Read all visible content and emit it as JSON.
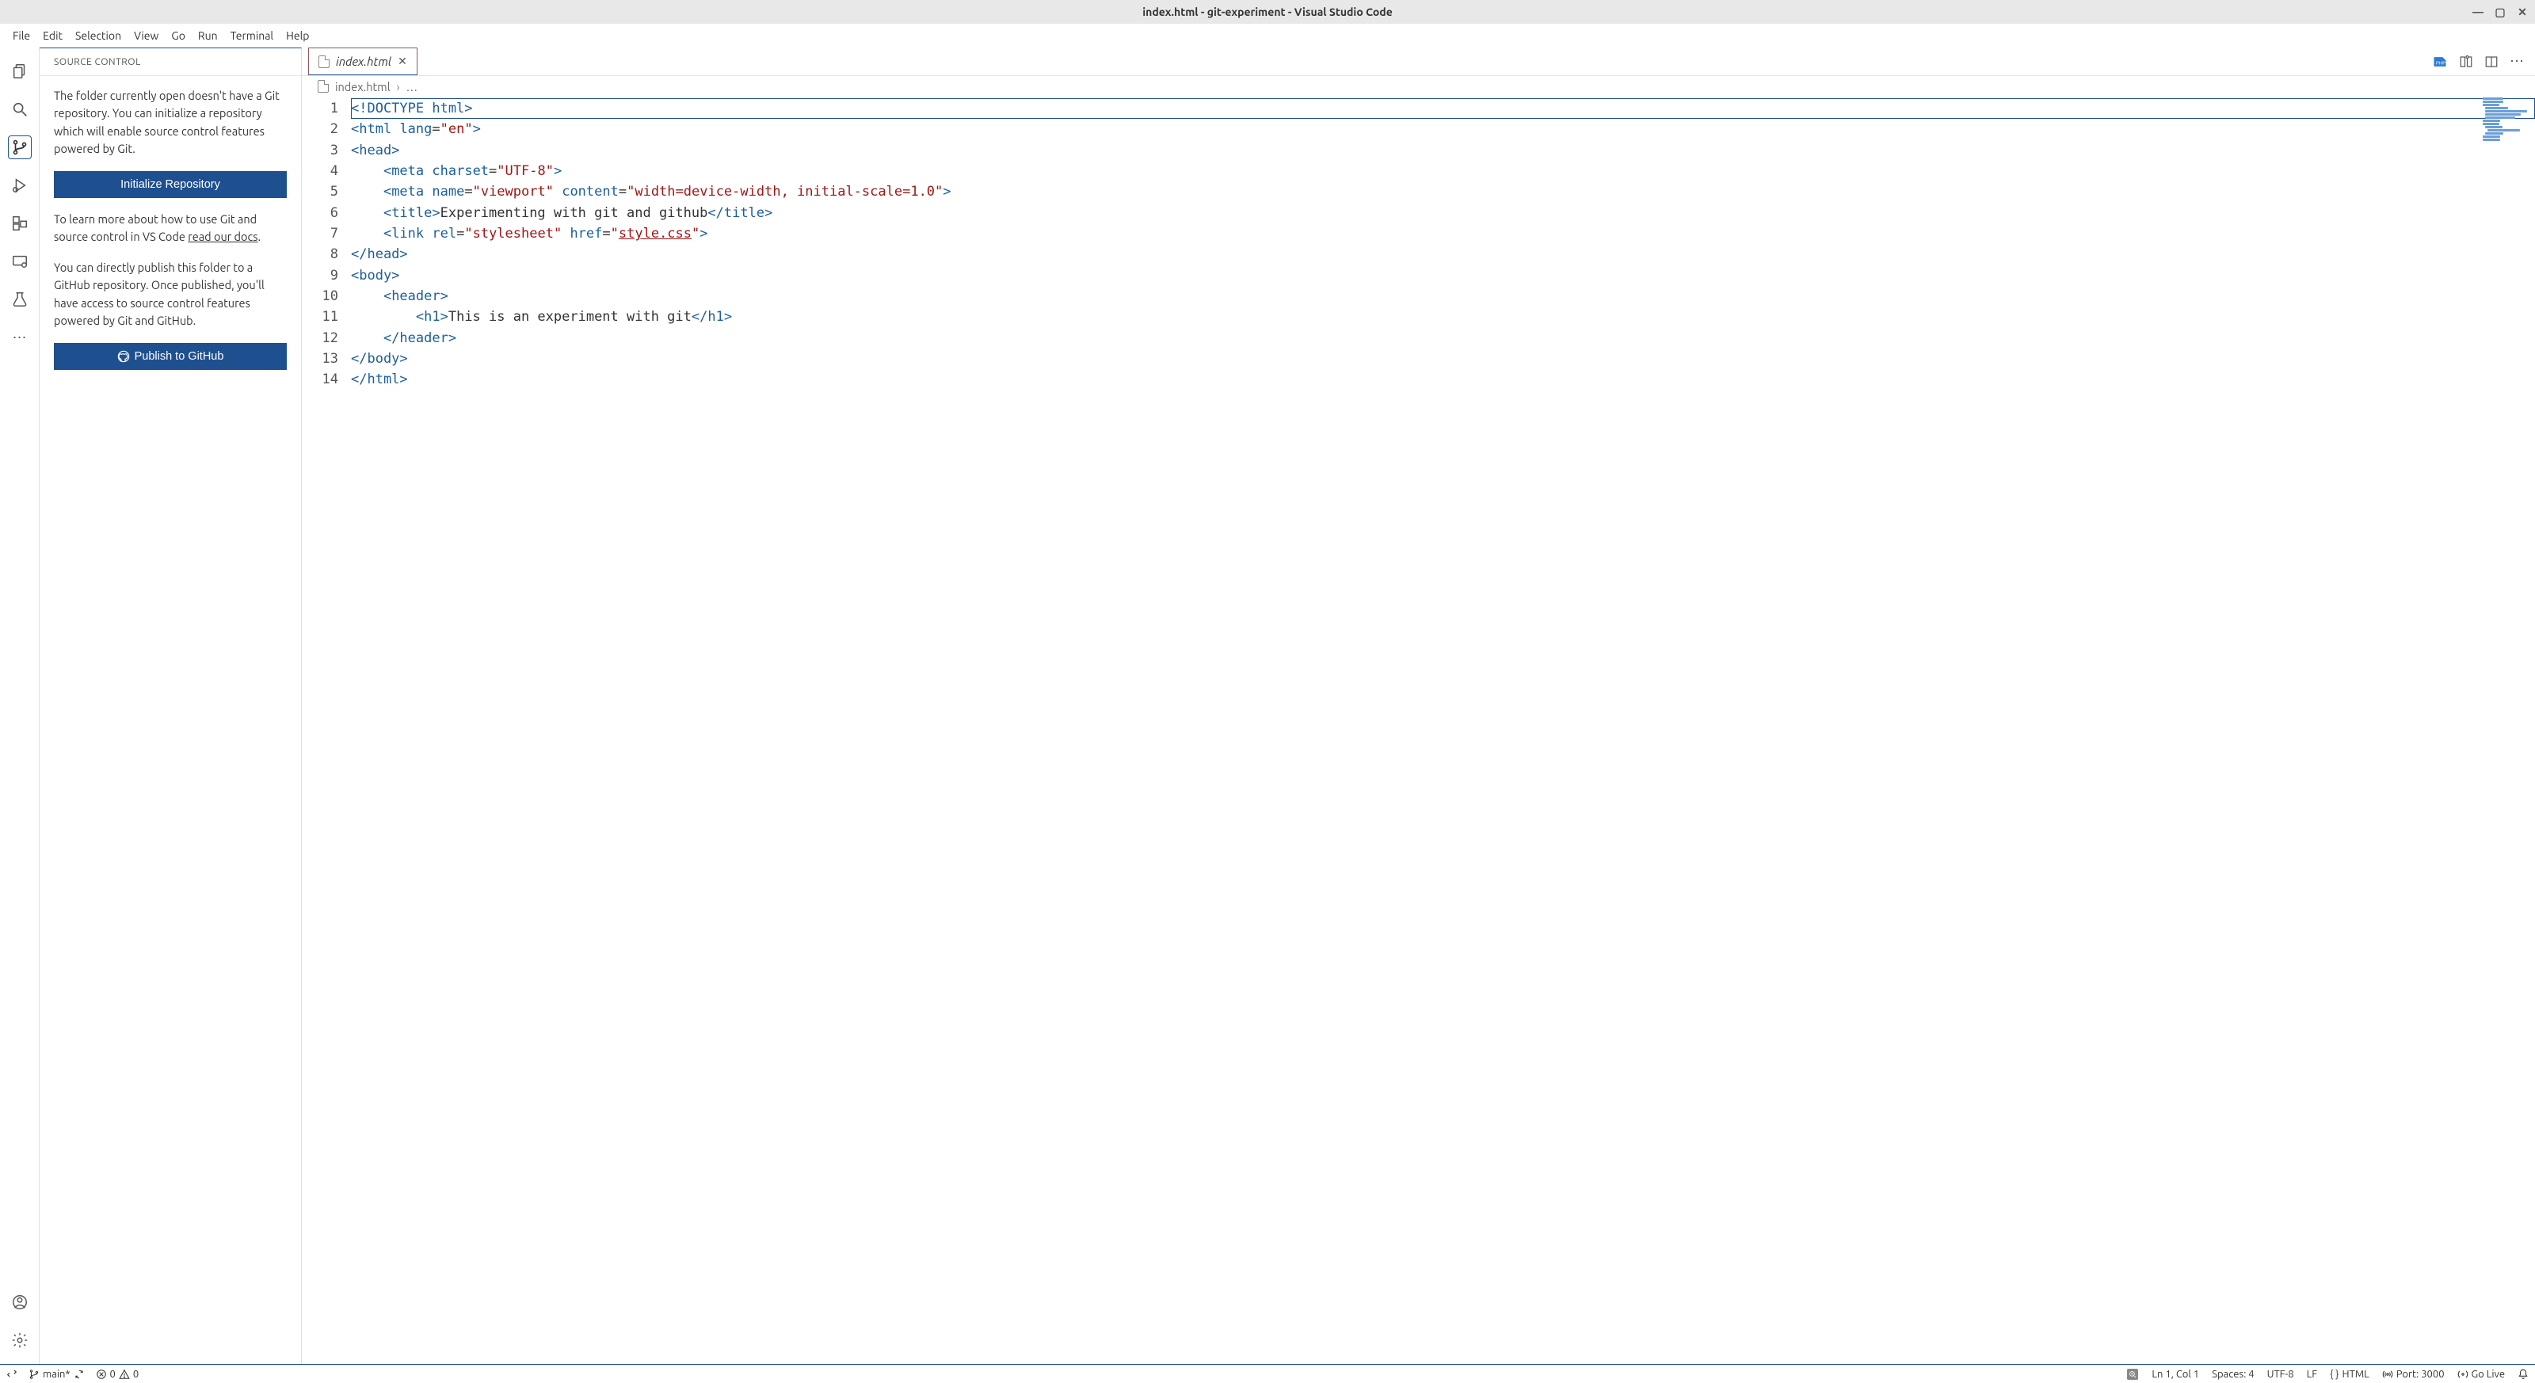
{
  "window": {
    "title": "index.html - git-experiment - Visual Studio Code"
  },
  "menubar": [
    "File",
    "Edit",
    "Selection",
    "View",
    "Go",
    "Run",
    "Terminal",
    "Help"
  ],
  "sidebar": {
    "title": "SOURCE CONTROL",
    "p1": "The folder currently open doesn't have a Git repository. You can initialize a repository which will enable source control features powered by Git.",
    "init_button": "Initialize Repository",
    "p2a": "To learn more about how to use Git and source control in VS Code ",
    "p2_link": "read our docs",
    "p2b": ".",
    "p3": "You can directly publish this folder to a GitHub repository. Once published, you'll have access to source control features powered by Git and GitHub.",
    "publish_button": "Publish to GitHub"
  },
  "tab": {
    "file": "index.html"
  },
  "breadcrumb": {
    "file": "index.html",
    "ellipsis": "…"
  },
  "code": {
    "lines": [
      {
        "n": "1",
        "html": "<span class='tok-doctype'>&lt;!DOCTYPE html&gt;</span>",
        "indent": 0,
        "hl": true
      },
      {
        "n": "2",
        "html": "<span class='tok-tag'>&lt;html</span> <span class='tok-attr'>lang</span>=<span class='tok-str'>\"en\"</span><span class='tok-tag'>&gt;</span>",
        "indent": 0
      },
      {
        "n": "3",
        "html": "<span class='tok-tag'>&lt;head&gt;</span>",
        "indent": 0
      },
      {
        "n": "4",
        "html": "<span class='tok-tag'>&lt;meta</span> <span class='tok-attr'>charset</span>=<span class='tok-str'>\"UTF-8\"</span><span class='tok-tag'>&gt;</span>",
        "indent": 1
      },
      {
        "n": "5",
        "html": "<span class='tok-tag'>&lt;meta</span> <span class='tok-attr'>name</span>=<span class='tok-str'>\"viewport\"</span> <span class='tok-attr'>content</span>=<span class='tok-str'>\"width=device-width, initial-scale=1.0\"</span><span class='tok-tag'>&gt;</span>",
        "indent": 1
      },
      {
        "n": "6",
        "html": "<span class='tok-tag'>&lt;title&gt;</span><span class='tok-text'>Experimenting with git and github</span><span class='tok-tag'>&lt;/title&gt;</span>",
        "indent": 1
      },
      {
        "n": "7",
        "html": "<span class='tok-tag'>&lt;link</span> <span class='tok-attr'>rel</span>=<span class='tok-str'>\"stylesheet\"</span> <span class='tok-attr'>href</span>=<span class='tok-str'>\"<span class='underlined'>style.css</span>\"</span><span class='tok-tag'>&gt;</span>",
        "indent": 1
      },
      {
        "n": "8",
        "html": "<span class='tok-tag'>&lt;/head&gt;</span>",
        "indent": 0
      },
      {
        "n": "9",
        "html": "<span class='tok-tag'>&lt;body&gt;</span>",
        "indent": 0
      },
      {
        "n": "10",
        "html": "<span class='tok-tag'>&lt;header&gt;</span>",
        "indent": 1
      },
      {
        "n": "11",
        "html": "<span class='tok-tag'>&lt;h1&gt;</span><span class='tok-text'>This is an experiment with git</span><span class='tok-tag'>&lt;/h1&gt;</span>",
        "indent": 2
      },
      {
        "n": "12",
        "html": "<span class='tok-tag'>&lt;/header&gt;</span>",
        "indent": 1
      },
      {
        "n": "13",
        "html": "<span class='tok-tag'>&lt;/body&gt;</span>",
        "indent": 0
      },
      {
        "n": "14",
        "html": "<span class='tok-tag'>&lt;/html&gt;</span>",
        "indent": 0
      }
    ]
  },
  "statusbar": {
    "branch": "main*",
    "errors": "0",
    "warnings": "0",
    "cursor": "Ln 1, Col 1",
    "spaces": "Spaces: 4",
    "encoding": "UTF-8",
    "eol": "LF",
    "lang": "HTML",
    "port": "Port: 3000",
    "golive": "Go Live"
  }
}
